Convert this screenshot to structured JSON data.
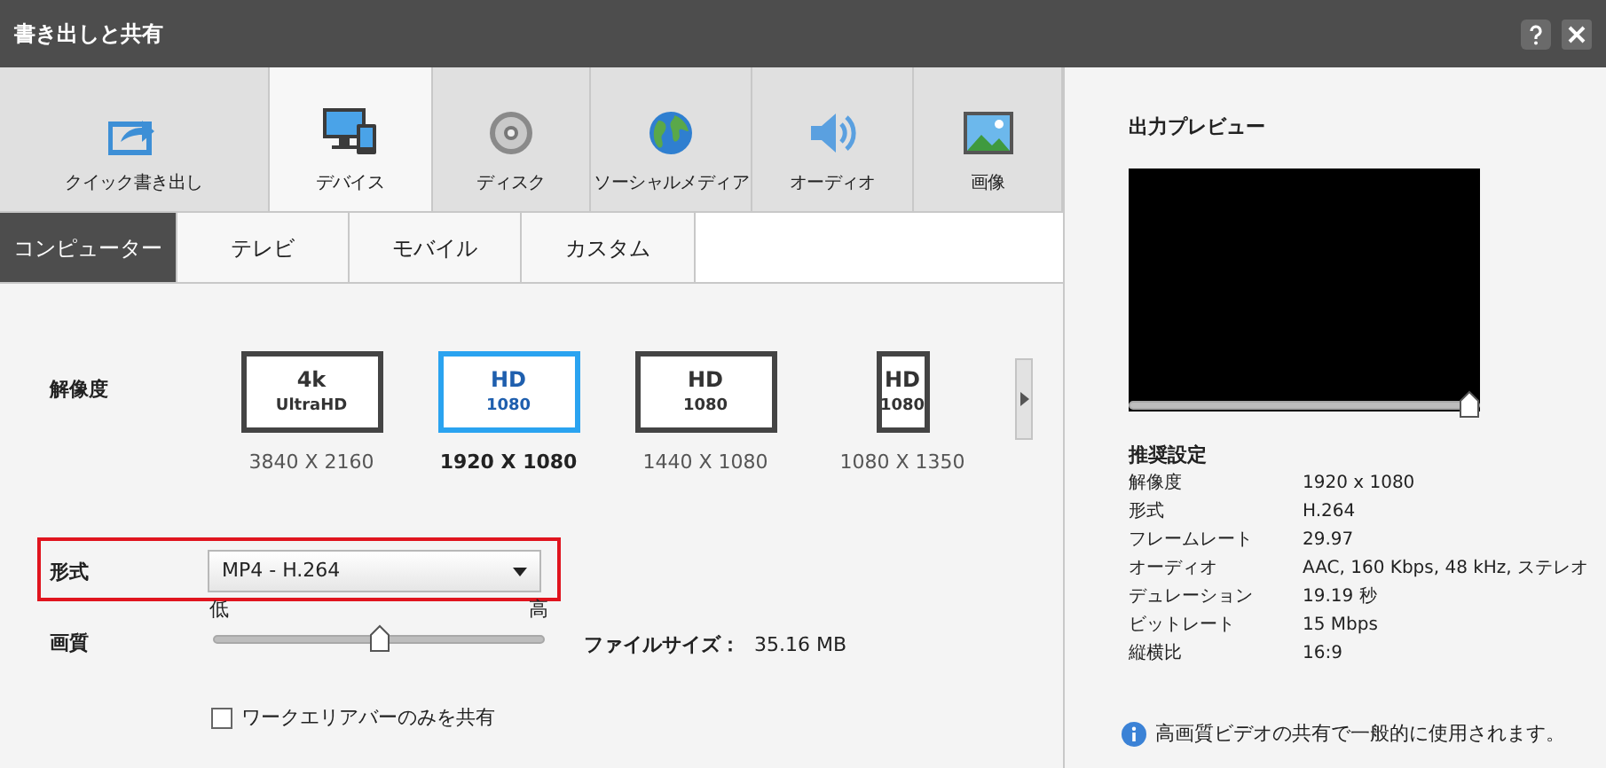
{
  "window": {
    "title": "書き出しと共有"
  },
  "main_tabs": [
    {
      "label": "クイック書き出し",
      "selected": false
    },
    {
      "label": "デバイス",
      "selected": true
    },
    {
      "label": "ディスク",
      "selected": false
    },
    {
      "label": "ソーシャルメディア",
      "selected": false
    },
    {
      "label": "オーディオ",
      "selected": false
    },
    {
      "label": "画像",
      "selected": false
    }
  ],
  "sub_tabs": [
    {
      "label": "コンピューター",
      "selected": true
    },
    {
      "label": "テレビ",
      "selected": false
    },
    {
      "label": "モバイル",
      "selected": false
    },
    {
      "label": "カスタム",
      "selected": false
    }
  ],
  "resolution": {
    "label": "解像度",
    "options": [
      {
        "kind": "landscape",
        "line1": "4k",
        "line2": "UltraHD",
        "caption": "3840 X 2160",
        "selected": false
      },
      {
        "kind": "landscape",
        "line1": "HD",
        "line2": "1080",
        "caption": "1920 X 1080",
        "selected": true
      },
      {
        "kind": "landscape",
        "line1": "HD",
        "line2": "1080",
        "caption": "1440 X 1080",
        "selected": false
      },
      {
        "kind": "portrait",
        "line1": "HD",
        "line2": "1080",
        "caption": "1080 X 1350",
        "selected": false
      }
    ]
  },
  "format": {
    "label": "形式",
    "value": "MP4 - H.264",
    "highlighted": true
  },
  "quality": {
    "label": "画質",
    "low": "低",
    "high": "高",
    "level": 0.5
  },
  "file_size": {
    "label": "ファイルサイズ：",
    "value": "35.16 MB"
  },
  "share_work_area": {
    "label": "ワークエリアバーのみを共有",
    "checked": false
  },
  "preview": {
    "title": "出力プレビュー",
    "level": 1
  },
  "recommended": {
    "title": "推奨設定",
    "rows": [
      {
        "label": "解像度",
        "value": "1920 x 1080"
      },
      {
        "label": "形式",
        "value": "H.264"
      },
      {
        "label": "フレームレート",
        "value": "29.97"
      },
      {
        "label": "オーディオ",
        "value": "AAC, 160 Kbps, 48 kHz, ステレオ"
      },
      {
        "label": "デュレーション",
        "value": "19.19 秒"
      },
      {
        "label": "ビットレート",
        "value": "15 Mbps"
      },
      {
        "label": "縦横比",
        "value": "16:9"
      }
    ]
  },
  "info": "高画質ビデオの共有で一般的に使用されます。"
}
